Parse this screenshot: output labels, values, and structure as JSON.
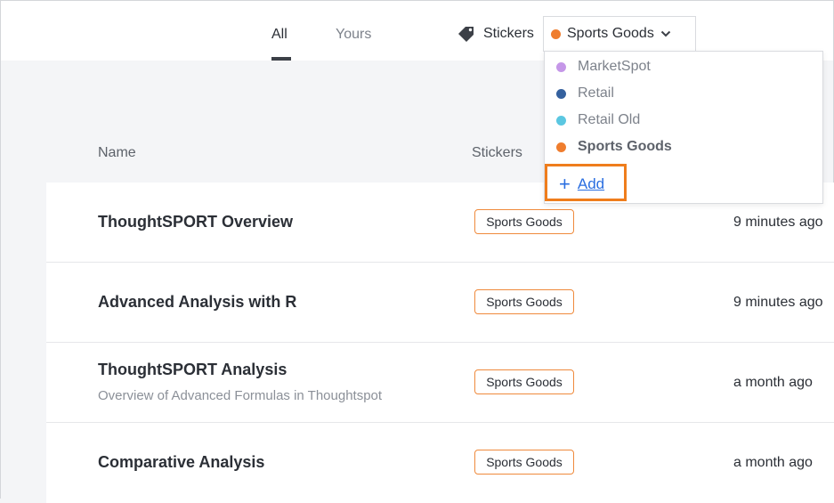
{
  "tabs": [
    {
      "label": "All",
      "active": true
    },
    {
      "label": "Yours",
      "active": false
    }
  ],
  "sticker_filter": {
    "label": "Stickers",
    "icon": "tag-icon"
  },
  "dropdown": {
    "selected": {
      "label": "Sports Goods",
      "color": "#ef7d2e"
    },
    "icon": "chevron-down-icon",
    "options": [
      {
        "label": "MarketSpot",
        "color": "#c597e8",
        "selected": false
      },
      {
        "label": "Retail",
        "color": "#35619e",
        "selected": false
      },
      {
        "label": "Retail Old",
        "color": "#5bc7e1",
        "selected": false
      },
      {
        "label": "Sports Goods",
        "color": "#ef7d2e",
        "selected": true
      }
    ],
    "add_label": "Add",
    "add_icon": "plus-icon",
    "highlight_color": "#ef7d1c"
  },
  "columns": {
    "name": "Name",
    "stickers": "Stickers"
  },
  "rows": [
    {
      "title": "ThoughtSPORT Overview",
      "description": "",
      "sticker": "Sports Goods",
      "time": "9 minutes ago"
    },
    {
      "title": "Advanced Analysis with R",
      "description": "",
      "sticker": "Sports Goods",
      "time": "9 minutes ago"
    },
    {
      "title": "ThoughtSPORT Analysis",
      "description": "Overview of Advanced Formulas in Thoughtspot",
      "sticker": "Sports Goods",
      "time": "a month ago"
    },
    {
      "title": "Comparative Analysis",
      "description": "",
      "sticker": "Sports Goods",
      "time": "a month ago"
    }
  ],
  "colors": {
    "sticker_border": "#ef8a3c",
    "link": "#2a6ee0"
  }
}
